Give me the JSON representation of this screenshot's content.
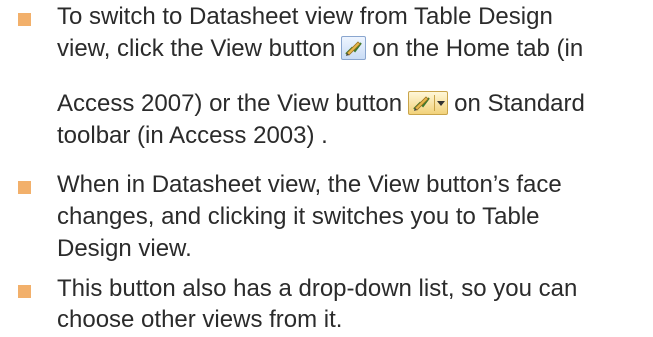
{
  "bullets": [
    {
      "lines": [
        "To switch to Datasheet view from Table Design",
        "view, click the View button",
        "on the Home tab (in",
        "Access 2007) or the View button",
        "on Standard",
        "toolbar (in Access 2003) ."
      ]
    },
    {
      "lines": [
        "When in Datasheet view, the View button’s face",
        "changes, and clicking it switches you to Table",
        "Design view."
      ]
    },
    {
      "lines": [
        "This button also has a drop-down list, so you can",
        "choose other views from it."
      ]
    }
  ],
  "icons": {
    "view_button_2007": "view-button-icon",
    "view_button_2003": "view-dropdown-button-icon"
  },
  "colors": {
    "bullet": "#f2b06b",
    "text": "#2b2b2b"
  }
}
